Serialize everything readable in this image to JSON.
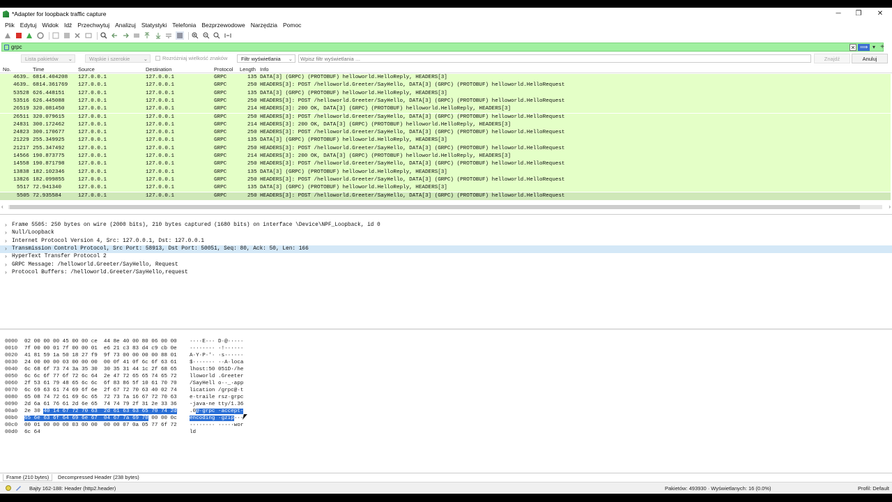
{
  "window": {
    "title": "*Adapter for loopback traffic capture",
    "controls": {
      "minimize": "─",
      "restore": "❐",
      "close": "✕"
    }
  },
  "menu": [
    "Plik",
    "Edytuj",
    "Widok",
    "Idź",
    "Przechwytuj",
    "Analizuj",
    "Statystyki",
    "Telefonia",
    "Bezprzewodowe",
    "Narzędzia",
    "Pomoc"
  ],
  "filter": {
    "value": "grpc"
  },
  "find": {
    "list_combo": "Lista pakietów",
    "width_combo": "Wąskie i szerokie",
    "case_label": "Rozróżniaj wielkość znaków",
    "mode_combo": "Filtr wyświetlania",
    "search_placeholder": "Wpisz filtr wyświetlania …",
    "find_button": "Znajdź",
    "cancel_button": "Anuluj"
  },
  "packet_list": {
    "columns": [
      "No.",
      "Time",
      "Source",
      "Destination",
      "Protocol",
      "Length",
      "Info"
    ],
    "rows": [
      {
        "no": "4639…",
        "time": "6814.404208",
        "src": "127.0.0.1",
        "dst": "127.0.0.1",
        "proto": "GRPC",
        "len": "135",
        "info": "DATA[3] (GRPC) (PROTOBUF) helloworld.HelloReply, HEADERS[3]"
      },
      {
        "no": "4639…",
        "time": "6814.361769",
        "src": "127.0.0.1",
        "dst": "127.0.0.1",
        "proto": "GRPC",
        "len": "250",
        "info": "HEADERS[3]: POST /helloworld.Greeter/SayHello, DATA[3] (GRPC) (PROTOBUF) helloworld.HelloRequest"
      },
      {
        "no": "53528",
        "time": "626.448151",
        "src": "127.0.0.1",
        "dst": "127.0.0.1",
        "proto": "GRPC",
        "len": "135",
        "info": "DATA[3] (GRPC) (PROTOBUF) helloworld.HelloReply, HEADERS[3]"
      },
      {
        "no": "53516",
        "time": "626.445088",
        "src": "127.0.0.1",
        "dst": "127.0.0.1",
        "proto": "GRPC",
        "len": "250",
        "info": "HEADERS[3]: POST /helloworld.Greeter/SayHello, DATA[3] (GRPC) (PROTOBUF) helloworld.HelloRequest"
      },
      {
        "no": "26519",
        "time": "320.081450",
        "src": "127.0.0.1",
        "dst": "127.0.0.1",
        "proto": "GRPC",
        "len": "214",
        "info": "HEADERS[3]: 200 OK, DATA[3] (GRPC) (PROTOBUF) helloworld.HelloReply, HEADERS[3]"
      },
      {
        "no": "26511",
        "time": "320.079615",
        "src": "127.0.0.1",
        "dst": "127.0.0.1",
        "proto": "GRPC",
        "len": "250",
        "info": "HEADERS[3]: POST /helloworld.Greeter/SayHello, DATA[3] (GRPC) (PROTOBUF) helloworld.HelloRequest"
      },
      {
        "no": "24831",
        "time": "300.172462",
        "src": "127.0.0.1",
        "dst": "127.0.0.1",
        "proto": "GRPC",
        "len": "214",
        "info": "HEADERS[3]: 200 OK, DATA[3] (GRPC) (PROTOBUF) helloworld.HelloReply, HEADERS[3]"
      },
      {
        "no": "24823",
        "time": "300.170677",
        "src": "127.0.0.1",
        "dst": "127.0.0.1",
        "proto": "GRPC",
        "len": "250",
        "info": "HEADERS[3]: POST /helloworld.Greeter/SayHello, DATA[3] (GRPC) (PROTOBUF) helloworld.HelloRequest"
      },
      {
        "no": "21229",
        "time": "255.349925",
        "src": "127.0.0.1",
        "dst": "127.0.0.1",
        "proto": "GRPC",
        "len": "135",
        "info": "DATA[3] (GRPC) (PROTOBUF) helloworld.HelloReply, HEADERS[3]"
      },
      {
        "no": "21217",
        "time": "255.347492",
        "src": "127.0.0.1",
        "dst": "127.0.0.1",
        "proto": "GRPC",
        "len": "250",
        "info": "HEADERS[3]: POST /helloworld.Greeter/SayHello, DATA[3] (GRPC) (PROTOBUF) helloworld.HelloRequest"
      },
      {
        "no": "14566",
        "time": "190.873775",
        "src": "127.0.0.1",
        "dst": "127.0.0.1",
        "proto": "GRPC",
        "len": "214",
        "info": "HEADERS[3]: 200 OK, DATA[3] (GRPC) (PROTOBUF) helloworld.HelloReply, HEADERS[3]"
      },
      {
        "no": "14558",
        "time": "190.871798",
        "src": "127.0.0.1",
        "dst": "127.0.0.1",
        "proto": "GRPC",
        "len": "250",
        "info": "HEADERS[3]: POST /helloworld.Greeter/SayHello, DATA[3] (GRPC) (PROTOBUF) helloworld.HelloRequest"
      },
      {
        "no": "13838",
        "time": "182.102346",
        "src": "127.0.0.1",
        "dst": "127.0.0.1",
        "proto": "GRPC",
        "len": "135",
        "info": "DATA[3] (GRPC) (PROTOBUF) helloworld.HelloReply, HEADERS[3]"
      },
      {
        "no": "13826",
        "time": "182.099855",
        "src": "127.0.0.1",
        "dst": "127.0.0.1",
        "proto": "GRPC",
        "len": "250",
        "info": "HEADERS[3]: POST /helloworld.Greeter/SayHello, DATA[3] (GRPC) (PROTOBUF) helloworld.HelloRequest"
      },
      {
        "no": "5517",
        "time": "72.941340",
        "src": "127.0.0.1",
        "dst": "127.0.0.1",
        "proto": "GRPC",
        "len": "135",
        "info": "DATA[3] (GRPC) (PROTOBUF) helloworld.HelloReply, HEADERS[3]"
      },
      {
        "no": "5505",
        "time": "72.935584",
        "src": "127.0.0.1",
        "dst": "127.0.0.1",
        "proto": "GRPC",
        "len": "250",
        "info": "HEADERS[3]: POST /helloworld.Greeter/SayHello, DATA[3] (GRPC) (PROTOBUF) helloworld.HelloRequest",
        "selected": true
      }
    ]
  },
  "details": [
    {
      "text": "Frame 5505: 250 bytes on wire (2000 bits), 210 bytes captured (1680 bits) on interface \\Device\\NPF_Loopback, id 0"
    },
    {
      "text": "Null/Loopback"
    },
    {
      "text": "Internet Protocol Version 4, Src: 127.0.0.1, Dst: 127.0.0.1"
    },
    {
      "text": "Transmission Control Protocol, Src Port: 58913, Dst Port: 50051, Seq: 80, Ack: 50, Len: 166",
      "highlighted": true
    },
    {
      "text": "HyperText Transfer Protocol 2"
    },
    {
      "text": "GRPC Message: /helloworld.Greeter/SayHello, Request"
    },
    {
      "text": "Protocol Buffers: /helloworld.Greeter/SayHello,request"
    }
  ],
  "bytes": [
    {
      "off": "0000",
      "hex": "02 00 00 00 45 00 00 ce  44 8e 40 00 80 06 00 00",
      "asc": "····E··· D·@·····"
    },
    {
      "off": "0010",
      "hex": "7f 00 00 01 7f 00 00 01  e6 21 c3 83 d4 c9 cb 0e",
      "asc": "········ ·!······"
    },
    {
      "off": "0020",
      "hex": "41 81 59 1a 50 18 27 f9  9f 73 00 00 00 00 88 01",
      "asc": "A·Y·P·'· ·s······"
    },
    {
      "off": "0030",
      "hex": "24 00 00 00 03 00 00 00  00 0f 41 0f 6c 6f 63 61",
      "asc": "$······· ··A·loca"
    },
    {
      "off": "0040",
      "hex": "6c 68 6f 73 74 3a 35 30  30 35 31 44 1c 2f 68 65",
      "asc": "lhost:50 051D·/he"
    },
    {
      "off": "0050",
      "hex": "6c 6c 6f 77 6f 72 6c 64  2e 47 72 65 65 74 65 72",
      "asc": "lloworld .Greeter"
    },
    {
      "off": "0060",
      "hex": "2f 53 61 79 48 65 6c 6c  6f 83 86 5f 10 61 70 70",
      "asc": "/SayHell o··_·app"
    },
    {
      "off": "0070",
      "hex": "6c 69 63 61 74 69 6f 6e  2f 67 72 70 63 40 02 74",
      "asc": "lication /grpc@·t"
    },
    {
      "off": "0080",
      "hex": "65 08 74 72 61 69 6c 65  72 73 7a 16 67 72 70 63",
      "asc": "e·traile rsz·grpc"
    },
    {
      "off": "0090",
      "hex": "2d 6a 61 76 61 2d 6e 65  74 74 79 2f 31 2e 33 36",
      "asc": "-java-ne tty/1.36"
    },
    {
      "off": "00a0",
      "hex": "2e 30 ",
      "hexsel": "40 14 67 72 70 63  2d 61 63 63 65 70 74 2d",
      "asc": ".0",
      "ascsel": "@·grpc -accept-"
    },
    {
      "off": "00b0",
      "hex": "",
      "hexsel": "65 6e 63 6f 64 69 6e 67  04 67 7a 69 70",
      "hextail": " 00 00 0c",
      "asc": "",
      "ascsel": "encoding ·gzip",
      "asctail": "···"
    },
    {
      "off": "00c0",
      "hex": "00 01 00 00 00 03 00 00  00 00 07 0a 05 77 6f 72",
      "asc": "········ ·····wor"
    },
    {
      "off": "00d0",
      "hex": "6c 64",
      "asc": "ld"
    }
  ],
  "bottom_tabs": [
    "Frame (210 bytes)",
    "Decompressed Header (238 bytes)"
  ],
  "status": {
    "field": "Bajty 162-188: Header (http2.header)",
    "counts": "Pakietów: 493930 · Wyświetlanych: 16 (0.0%)",
    "profile": "Profil: Default"
  },
  "colors": {
    "row_bg": "#e4ffc7",
    "filter_bg": "#a0f0a0",
    "detail_highlight": "#d4e8f7",
    "byte_selection": "#2a6fd6"
  }
}
